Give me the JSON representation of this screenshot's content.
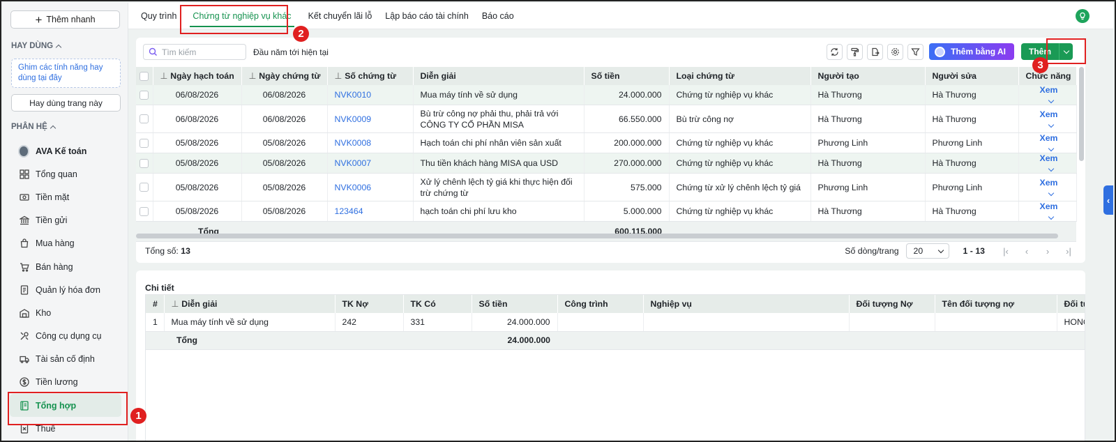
{
  "sidebar": {
    "quick_add": "Thêm nhanh",
    "hay_dung_title": "HAY DÙNG",
    "pin_hint": "Ghim các tính năng hay dùng tại đây",
    "hay_dung_page": "Hay dùng trang này",
    "phan_he_title": "PHÂN HỆ",
    "items": [
      {
        "label": "AVA Kế toán",
        "icon": "avatar-icon"
      },
      {
        "label": "Tổng quan",
        "icon": "dashboard-icon"
      },
      {
        "label": "Tiền mặt",
        "icon": "cash-icon"
      },
      {
        "label": "Tiền gửi",
        "icon": "bank-icon"
      },
      {
        "label": "Mua hàng",
        "icon": "shopping-bag-icon"
      },
      {
        "label": "Bán hàng",
        "icon": "cart-icon"
      },
      {
        "label": "Quản lý hóa đơn",
        "icon": "invoice-icon"
      },
      {
        "label": "Kho",
        "icon": "warehouse-icon"
      },
      {
        "label": "Công cụ dụng cụ",
        "icon": "tools-icon"
      },
      {
        "label": "Tài sản cố định",
        "icon": "truck-icon"
      },
      {
        "label": "Tiền lương",
        "icon": "dollar-icon"
      },
      {
        "label": "Tổng hợp",
        "icon": "book-icon"
      },
      {
        "label": "Thuế",
        "icon": "tax-icon"
      }
    ]
  },
  "tabs": [
    "Quy trình",
    "Chứng từ nghiệp vụ khác",
    "Kết chuyển lãi lỗ",
    "Lập báo cáo tài chính",
    "Báo cáo"
  ],
  "toolbar": {
    "search_placeholder": "Tìm kiếm",
    "period": "Đầu năm tới hiện tại",
    "ai_label": "Thêm bằng AI",
    "add_label": "Thêm"
  },
  "table": {
    "headers": [
      "Ngày hạch toán",
      "Ngày chứng từ",
      "Số chứng từ",
      "Diễn giải",
      "Số tiền",
      "Loại chứng từ",
      "Người tạo",
      "Người sửa",
      "Chức năng"
    ],
    "rows": [
      {
        "ngay_ht": "06/08/2026",
        "ngay_ct": "06/08/2026",
        "so_ct": "NVK0010",
        "dien_giai": "Mua máy tính về sử dụng",
        "so_tien": "24.000.000",
        "loai": "Chứng từ nghiệp vụ khác",
        "nguoi_tao": "Hà Thương",
        "nguoi_sua": "Hà Thương",
        "action": "Xem"
      },
      {
        "ngay_ht": "06/08/2026",
        "ngay_ct": "06/08/2026",
        "so_ct": "NVK0009",
        "dien_giai": "Bù trừ công nợ phải thu, phải trả với CÔNG TY CỔ PHẦN MISA",
        "so_tien": "66.550.000",
        "loai": "Bù trừ công nợ",
        "nguoi_tao": "Hà Thương",
        "nguoi_sua": "Hà Thương",
        "action": "Xem"
      },
      {
        "ngay_ht": "05/08/2026",
        "ngay_ct": "05/08/2026",
        "so_ct": "NVK0008",
        "dien_giai": "Hạch toán chi phí nhân viên sản xuất",
        "so_tien": "200.000.000",
        "loai": "Chứng từ nghiệp vụ khác",
        "nguoi_tao": "Phương Linh",
        "nguoi_sua": "Phương Linh",
        "action": "Xem"
      },
      {
        "ngay_ht": "05/08/2026",
        "ngay_ct": "05/08/2026",
        "so_ct": "NVK0007",
        "dien_giai": "Thu tiền khách hàng MISA qua USD",
        "so_tien": "270.000.000",
        "loai": "Chứng từ nghiệp vụ khác",
        "nguoi_tao": "Hà Thương",
        "nguoi_sua": "Hà Thương",
        "action": "Xem"
      },
      {
        "ngay_ht": "05/08/2026",
        "ngay_ct": "05/08/2026",
        "so_ct": "NVK0006",
        "dien_giai": " Xử lý chênh lệch tỷ giá khi thực hiện đối trừ chứng từ",
        "so_tien": "575.000",
        "loai": "Chứng từ xử lý chênh lệch tỷ giá",
        "nguoi_tao": "Phương Linh",
        "nguoi_sua": "Phương Linh",
        "action": "Xem"
      },
      {
        "ngay_ht": "05/08/2026",
        "ngay_ct": "05/08/2026",
        "so_ct": "123464",
        "dien_giai": "hạch toán chi phí lưu kho",
        "so_tien": "5.000.000",
        "loai": "Chứng từ nghiệp vụ khác",
        "nguoi_tao": "Hà Thương",
        "nguoi_sua": "Hà Thương",
        "action": "Xem"
      }
    ],
    "total_label": "Tổng",
    "total_amount": "600.115.000"
  },
  "footer": {
    "total_label": "Tổng số:",
    "total_count": "13",
    "rows_per_page_label": "Số dòng/trang",
    "rows_per_page": "20",
    "range": "1 - 13"
  },
  "detail": {
    "title": "Chi tiết",
    "headers": [
      "#",
      "Diễn giải",
      "TK Nợ",
      "TK Có",
      "Số tiền",
      "Công trình",
      "Nghiệp vụ",
      "Đối tượng Nợ",
      "Tên đối tượng nợ",
      "Đối tư"
    ],
    "rows": [
      {
        "no": "1",
        "dien_giai": "Mua máy tính về sử dụng",
        "tk_no": "242",
        "tk_co": "331",
        "so_tien": "24.000.000",
        "cong_trinh": "",
        "nghiep_vu": "",
        "dt_no": "",
        "ten_dt_no": "",
        "dt_co": "HONG"
      }
    ],
    "total_label": "Tổng",
    "total_amount": "24.000.000"
  },
  "annotations": [
    "1",
    "2",
    "3"
  ],
  "colors": {
    "accent": "#15924f",
    "link": "#2f6fe0",
    "highlight": "#e02020"
  }
}
